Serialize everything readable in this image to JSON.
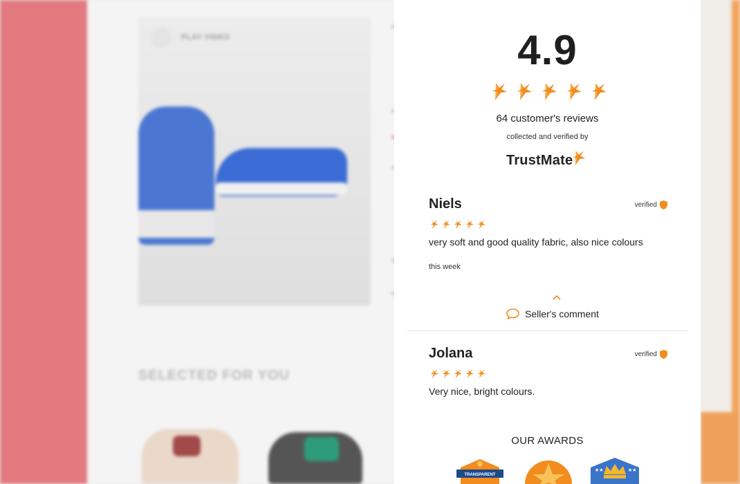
{
  "background": {
    "play_video_label": "PLAY VIDEO",
    "section_title": "SELECTED FOR YOU"
  },
  "widget": {
    "score": "4.9",
    "rating_stars": 5,
    "reviews_count": "64 customer's reviews",
    "collected_text": "collected and verified by",
    "logo_text": "TrustMate",
    "reviews": [
      {
        "name": "Niels",
        "verified_label": "verified",
        "stars": 5,
        "text": "very soft and good quality fabric, also nice colours",
        "time": "this week"
      },
      {
        "name": "Jolana",
        "verified_label": "verified",
        "stars": 5,
        "text": "Very nice, bright colours."
      }
    ],
    "seller_comment_label": "Seller's comment",
    "awards_title": "OUR AWARDS",
    "awards": [
      {
        "name": "transparent-award",
        "label": "TRANSPARENT"
      },
      {
        "name": "star-award",
        "label": ""
      },
      {
        "name": "crown-award",
        "label": ""
      }
    ]
  },
  "colors": {
    "accent_orange": "#f28c1e",
    "left_strip": "#e27a7f"
  }
}
